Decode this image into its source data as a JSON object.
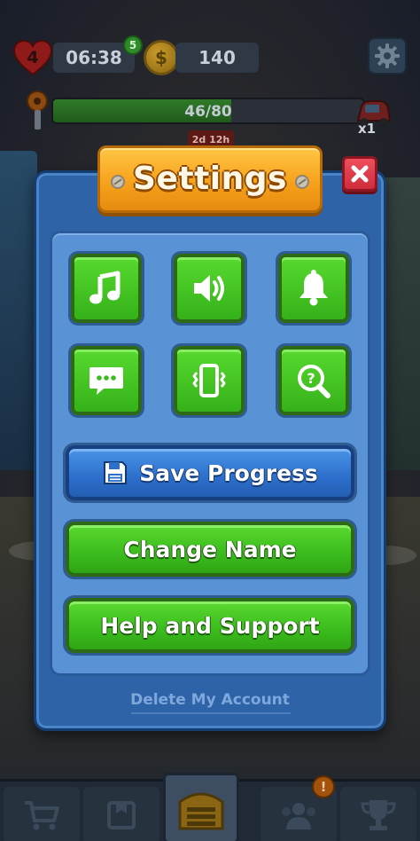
{
  "hud": {
    "lives": "4",
    "lives_timer": "06:38",
    "lives_bonus": "5",
    "coins": "140",
    "progress_text": "46/80",
    "progress_fraction": 0.575,
    "event_timer": "2d 12h",
    "chest_count": "x1"
  },
  "modal": {
    "title": "Settings",
    "icons": [
      {
        "icon": "music-note-icon"
      },
      {
        "icon": "speaker-icon"
      },
      {
        "icon": "bell-icon"
      },
      {
        "icon": "chat-icon"
      },
      {
        "icon": "vibration-icon"
      },
      {
        "icon": "help-search-icon"
      }
    ],
    "save_progress_label": "Save Progress",
    "change_name_label": "Change Name",
    "help_support_label": "Help and Support",
    "delete_account_label": "Delete My Account"
  },
  "bottom_nav": {
    "tabs": [
      "shop-icon",
      "collection-icon",
      "home-icon",
      "team-icon",
      "leaderboard-icon"
    ],
    "badge": "!"
  },
  "colors": {
    "accent_green": "#3bbb1d",
    "accent_blue": "#2c6fcc",
    "panel_blue": "#2f63a8",
    "title_orange": "#f7a21c",
    "close_red": "#cf2b3c"
  }
}
